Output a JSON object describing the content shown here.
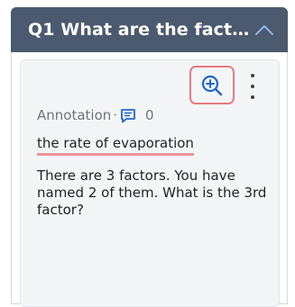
{
  "header": {
    "title": "Q1 What are the factors...",
    "collapse_icon": "chevron-up-icon"
  },
  "card": {
    "zoom_icon": "zoom-in-icon",
    "more_icon": "more-vertical-icon",
    "annotation_label": "Annotation",
    "annotation_separator": "·",
    "comment_icon": "comment-icon",
    "annotation_count": "0",
    "highlighted_text": "the rate of evaporation",
    "feedback": "There are 3 factors. You have named 2 of them. What is the 3rd factor?"
  },
  "colors": {
    "header_bg": "#4b5a6e",
    "accent_blue": "#1f66c9",
    "highlight_underline": "#e8949a",
    "focus_border": "#e47a80"
  }
}
